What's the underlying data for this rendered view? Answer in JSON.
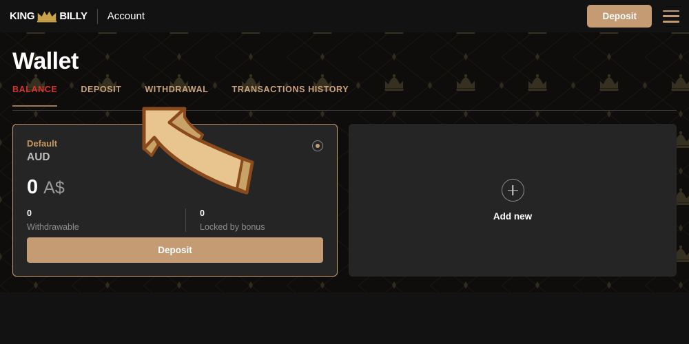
{
  "header": {
    "brand_left": "KING",
    "brand_right": "BILLY",
    "brand_crown_icon": "crown-icon",
    "section_label": "Account",
    "deposit_label": "Deposit",
    "menu_icon": "hamburger-menu-icon"
  },
  "page": {
    "title": "Wallet"
  },
  "tabs": [
    {
      "label": "BALANCE",
      "active": true
    },
    {
      "label": "DEPOSIT",
      "active": false
    },
    {
      "label": "WITHDRAWAL",
      "active": false
    },
    {
      "label": "TRANSACTIONS HISTORY",
      "active": false
    }
  ],
  "balance_card": {
    "name": "Default",
    "currency": "AUD",
    "amount": "0",
    "amount_currency_symbol": "A$",
    "selected": true,
    "radio_icon": "radio-selected-icon",
    "withdrawable_value": "0",
    "withdrawable_label": "Withdrawable",
    "locked_value": "0",
    "locked_label": "Locked by bonus",
    "deposit_label": "Deposit"
  },
  "add_new_card": {
    "plus_icon": "plus-circle-icon",
    "label": "Add new"
  },
  "annotation": {
    "arrow_icon": "curved-arrow-up-left-icon"
  },
  "colors": {
    "accent_gold": "#c59b74",
    "active_tab_red": "#d6342c",
    "tab_tan": "#c9a37c",
    "card_bg": "#252525",
    "page_bg": "#121212"
  }
}
